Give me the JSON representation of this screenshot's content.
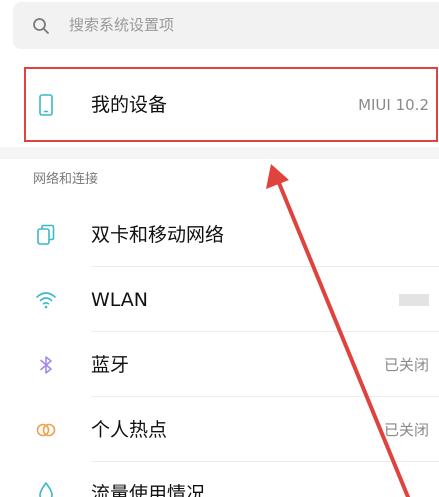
{
  "search": {
    "placeholder": "搜索系统设置项"
  },
  "device_row": {
    "label": "我的设备",
    "value": "MIUI 10.2"
  },
  "section": {
    "title": "网络和连接"
  },
  "items": [
    {
      "label": "双卡和移动网络",
      "value": "",
      "icon": "sim-card-icon"
    },
    {
      "label": "WLAN",
      "value": "",
      "icon": "wifi-icon"
    },
    {
      "label": "蓝牙",
      "value": "已关闭",
      "icon": "bluetooth-icon"
    },
    {
      "label": "个人热点",
      "value": "已关闭",
      "icon": "hotspot-icon"
    },
    {
      "label": "流量使用情况",
      "value": "",
      "icon": "data-usage-icon"
    }
  ],
  "colors": {
    "annotation_red": "#e0433d",
    "icon_teal": "#3cb8c8"
  }
}
